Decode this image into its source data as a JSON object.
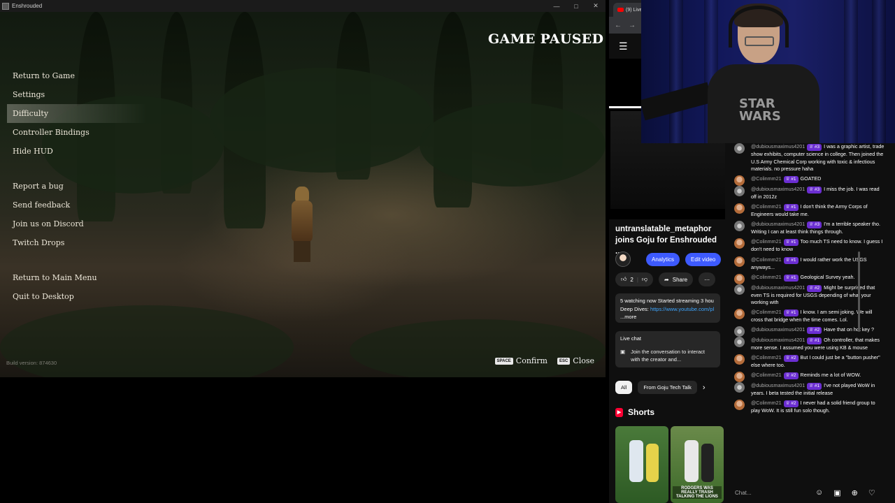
{
  "window": {
    "title": "Enshrouded",
    "controls": [
      "—",
      "□",
      "✕"
    ]
  },
  "game": {
    "paused_title": "GAME PAUSED",
    "menu_group1": [
      "Return to Game",
      "Settings",
      "Difficulty",
      "Controller Bindings",
      "Hide HUD"
    ],
    "menu_group2": [
      "Report a bug",
      "Send feedback",
      "Join us on Discord",
      "Twitch Drops"
    ],
    "menu_group3": [
      "Return to Main Menu",
      "Quit to Desktop"
    ],
    "active_item": "Difficulty",
    "build_version": "Build version:  874630",
    "hint_confirm_key": "SPACE",
    "hint_confirm_label": "Confirm",
    "hint_close_key": "ESC",
    "hint_close_label": "Close"
  },
  "browser": {
    "tab_label": "(9) Live",
    "nav_back": "←",
    "nav_forward": "→",
    "video_title": "untranslatable_metaphor joins Goju for Enshrouded ...",
    "analytics_label": "Analytics",
    "edit_video_label": "Edit video",
    "like_count": "2",
    "share_label": "Share",
    "description": "5 watching now  Started streaming 3 hou",
    "description_line2": "Deep Dives: ",
    "description_link": "https://www.youtube.com/pl",
    "more_label": "...more",
    "live_chat_title": "Live chat",
    "live_chat_text": "Join the conversation to interact with the creator and...",
    "chip_all": "All",
    "chip_from": "From Goju Tech Talk",
    "shorts_label": "Shorts",
    "short2_caption": "RODGERS WAS REALLY TRASH TALKING THE LIONS"
  },
  "webcam": {
    "shirt_text": "STAR WARS"
  },
  "chat": {
    "messages": [
      {
        "user": "@dubiousmaximus4201",
        "badge": "#3",
        "text": "I was a graphic artist, trade show exhibits, computer science in college. Then joined the U.S Army Chemical Corp working with toxic & infectious materials. no pressure haha",
        "avatar": "d"
      },
      {
        "user": "@Colinmm21",
        "badge": "#1",
        "text": "GOATED",
        "avatar": "c"
      },
      {
        "user": "@dubiousmaximus4201",
        "badge": "#3",
        "text": "I miss the job. I was read off in 2012z",
        "avatar": "d"
      },
      {
        "user": "@Colinmm21",
        "badge": "#1",
        "text": "I don't think the Army Corps of Engineers would take me.",
        "avatar": "c"
      },
      {
        "user": "@dubiousmaximus4201",
        "badge": "#3",
        "text": "I'm a terrible speaker tho. Writing I can at least think things through.",
        "avatar": "d"
      },
      {
        "user": "@Colinmm21",
        "badge": "#1",
        "text": "Too much TS need to know. I guess I don't need to know",
        "avatar": "c"
      },
      {
        "user": "@Colinmm21",
        "badge": "#1",
        "text": "I would rather work the USGS anyways...",
        "avatar": "c"
      },
      {
        "user": "@Colinmm21",
        "badge": "#1",
        "text": "Geological Survey yeah.",
        "avatar": "c"
      },
      {
        "user": "@dubiousmaximus4201",
        "badge": "#2",
        "text": "Might be surprised that even TS is required for USGS depending of what your working with",
        "avatar": "d"
      },
      {
        "user": "@Colinmm21",
        "badge": "#1",
        "text": "I know. I am semi joking. We will cross that bridge when the time comes. Lol.",
        "avatar": "c"
      },
      {
        "user": "@dubiousmaximus4201",
        "badge": "#2",
        "text": "Have that on hot key ?",
        "avatar": "d"
      },
      {
        "user": "@dubiousmaximus4201",
        "badge": "#1",
        "text": "Oh controller, that makes more sense. I assumed you were using KB & mouse",
        "avatar": "d"
      },
      {
        "user": "@Colinmm21",
        "badge": "#2",
        "text": "But I could just be a \"button pusher\" else where too.",
        "avatar": "c"
      },
      {
        "user": "@Colinmm21",
        "badge": "#2",
        "text": "Reminds me a lot of WOW.",
        "avatar": "c"
      },
      {
        "user": "@dubiousmaximus4201",
        "badge": "#1",
        "text": "I've not played WoW in years. I beta tested the initial release",
        "avatar": "d"
      },
      {
        "user": "@Colinmm21",
        "badge": "#2",
        "text": "I never had a solid friend group to play WoW. It is still fun solo though.",
        "avatar": "c"
      }
    ],
    "input_placeholder": "Chat...",
    "input_icons": [
      "☺",
      "▣",
      "⊕",
      "♡"
    ]
  }
}
